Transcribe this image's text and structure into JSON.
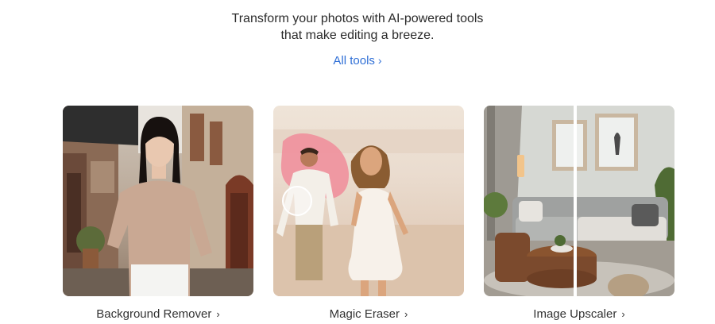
{
  "hero": {
    "line1": "Transform your photos with AI-powered tools",
    "line2": "that make editing a breeze."
  },
  "all_tools": {
    "label": "All tools",
    "chevron": "›"
  },
  "cards": [
    {
      "label": "Background Remover",
      "chevron": "›",
      "image": "woman-on-street-photo"
    },
    {
      "label": "Magic Eraser",
      "chevron": "›",
      "image": "couple-on-beach-photo"
    },
    {
      "label": "Image Upscaler",
      "chevron": "›",
      "image": "living-room-split-photo"
    }
  ],
  "colors": {
    "link": "#2f6fd6",
    "text": "#333333",
    "eraser_highlight": "#f08c9a"
  }
}
